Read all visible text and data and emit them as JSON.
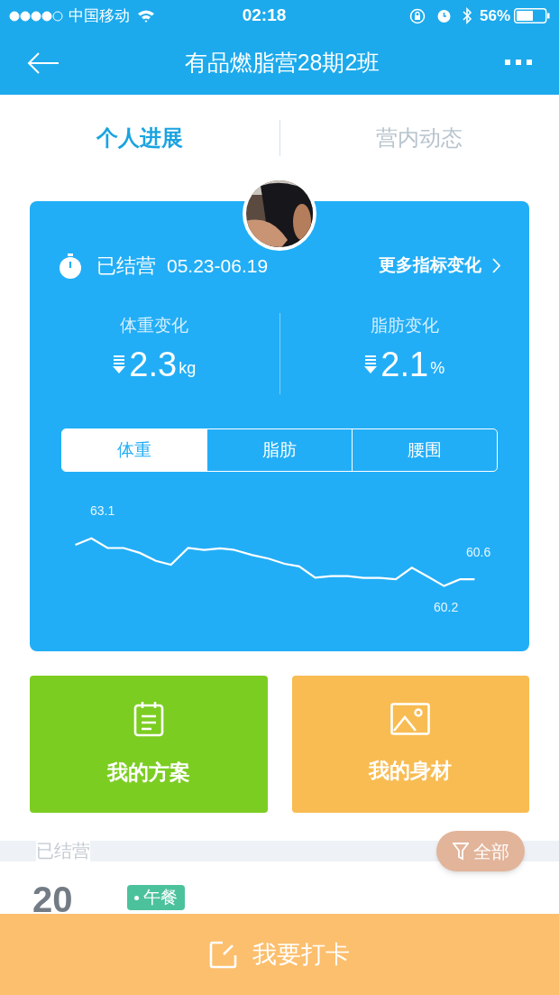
{
  "status_bar": {
    "carrier": "中国移动",
    "time": "02:18",
    "battery": "56%"
  },
  "nav": {
    "title": "有品燃脂营28期2班"
  },
  "tabs": [
    {
      "label": "个人进展",
      "selected": true
    },
    {
      "label": "营内动态",
      "selected": false
    }
  ],
  "card": {
    "status": "已结营",
    "dates": "05.23-06.19",
    "more_link": "更多指标变化",
    "stats": [
      {
        "label": "体重变化",
        "value": "2.3",
        "unit": "kg"
      },
      {
        "label": "脂肪变化",
        "value": "2.1",
        "unit": "%"
      }
    ],
    "segments": [
      {
        "label": "体重",
        "selected": true
      },
      {
        "label": "脂肪",
        "selected": false
      },
      {
        "label": "腰围",
        "selected": false
      }
    ],
    "chart_labels": [
      "63.1",
      "60.6",
      "60.2"
    ]
  },
  "actions": [
    {
      "label": "我的方案",
      "kind": "plan",
      "color": "#7ccd22"
    },
    {
      "label": "我的身材",
      "color": "#f8bc52"
    }
  ],
  "section": {
    "title": "已结营",
    "filter": "全部"
  },
  "record": {
    "day": "20",
    "tag": "午餐"
  },
  "checkin_button": {
    "label": "我要打卡"
  }
}
